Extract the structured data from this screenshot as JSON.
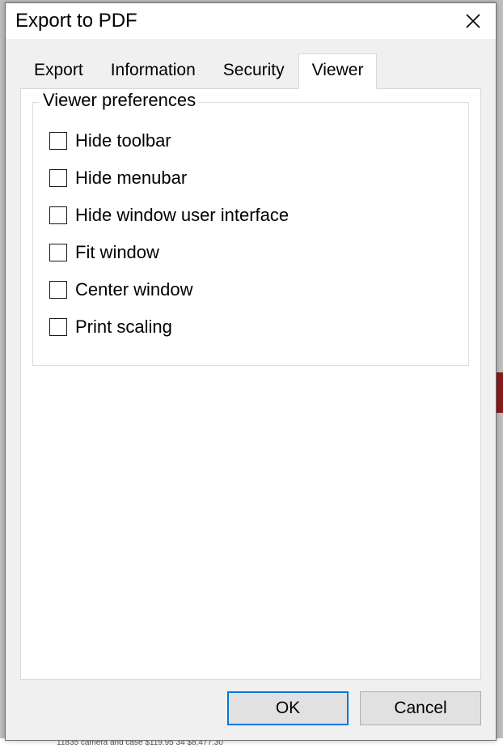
{
  "dialog": {
    "title": "Export to PDF"
  },
  "tabs": [
    {
      "label": "Export"
    },
    {
      "label": "Information"
    },
    {
      "label": "Security"
    },
    {
      "label": "Viewer"
    }
  ],
  "activeTabIndex": 3,
  "viewer": {
    "group_label": "Viewer preferences",
    "options": [
      {
        "label": "Hide toolbar",
        "checked": false
      },
      {
        "label": "Hide menubar",
        "checked": false
      },
      {
        "label": "Hide window user interface",
        "checked": false
      },
      {
        "label": "Fit window",
        "checked": false
      },
      {
        "label": "Center window",
        "checked": false
      },
      {
        "label": "Print scaling",
        "checked": false
      }
    ]
  },
  "buttons": {
    "ok": "OK",
    "cancel": "Cancel"
  },
  "background": {
    "bottom_row": "11835    camera and case                                         $119.95        34        $8,477.30"
  }
}
